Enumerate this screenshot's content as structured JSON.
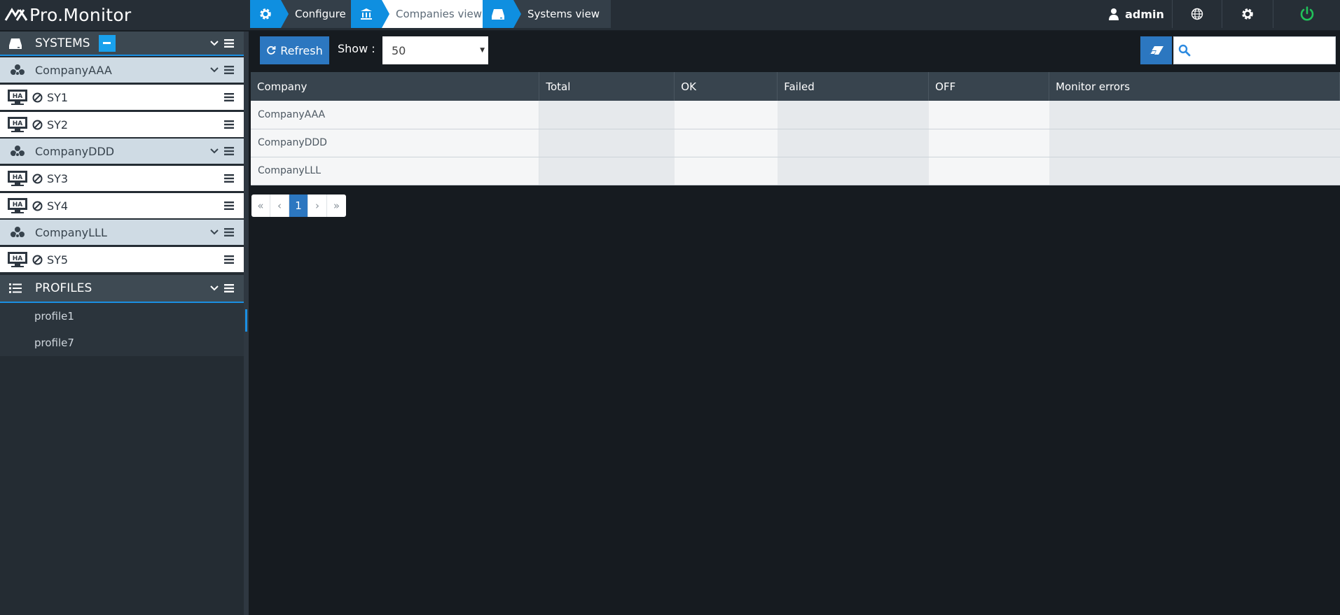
{
  "app": {
    "logo_text": "Pro.Monitor"
  },
  "breadcrumbs": [
    {
      "label": "Configure",
      "icon": "gear-icon"
    },
    {
      "label": "Companies view",
      "icon": "bank-icon"
    },
    {
      "label": "Systems view",
      "icon": "drive-icon"
    }
  ],
  "header": {
    "user": "admin"
  },
  "sidebar": {
    "systems_title": "SYSTEMS",
    "companies": [
      {
        "name": "CompanyAAA",
        "systems": [
          "SY1",
          "SY2"
        ]
      },
      {
        "name": "CompanyDDD",
        "systems": [
          "SY3",
          "SY4"
        ]
      },
      {
        "name": "CompanyLLL",
        "systems": [
          "SY5"
        ]
      }
    ],
    "ha_badge": "HA",
    "profiles_title": "PROFILES",
    "profiles": [
      "profile1",
      "profile7"
    ]
  },
  "toolbar": {
    "refresh_label": "Refresh",
    "show_label": "Show :",
    "show_value": "50",
    "search_placeholder": ""
  },
  "table": {
    "columns": [
      "Company",
      "Total",
      "OK",
      "Failed",
      "OFF",
      "Monitor errors"
    ],
    "rows": [
      [
        "CompanyAAA",
        "",
        "",
        "",
        "",
        ""
      ],
      [
        "CompanyDDD",
        "",
        "",
        "",
        "",
        ""
      ],
      [
        "CompanyLLL",
        "",
        "",
        "",
        "",
        ""
      ]
    ]
  },
  "pagination": {
    "first": "«",
    "prev": "‹",
    "current": "1",
    "next": "›",
    "last": "»"
  },
  "colors": {
    "accent": "#0f8fe0",
    "button": "#2c77c0",
    "power": "#21c25a"
  }
}
